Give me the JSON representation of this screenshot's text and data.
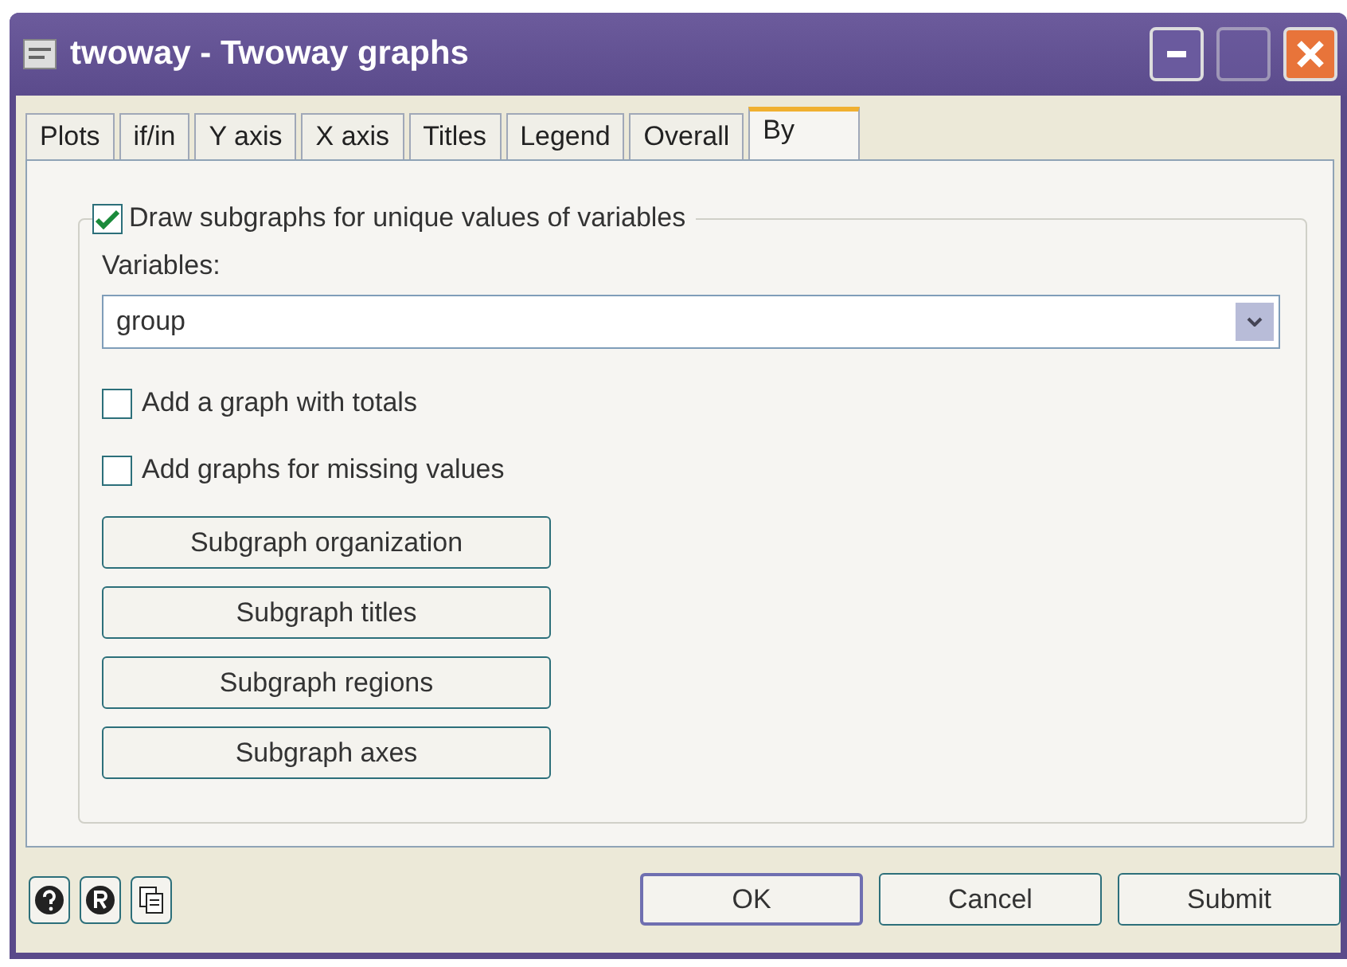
{
  "window": {
    "title": "twoway - Twoway graphs"
  },
  "tabs": [
    {
      "label": "Plots",
      "selected": false
    },
    {
      "label": "if/in",
      "selected": false
    },
    {
      "label": "Y axis",
      "selected": false
    },
    {
      "label": "X axis",
      "selected": false
    },
    {
      "label": "Titles",
      "selected": false
    },
    {
      "label": "Legend",
      "selected": false
    },
    {
      "label": "Overall",
      "selected": false
    },
    {
      "label": "By",
      "selected": true
    }
  ],
  "by_group": {
    "label": "Draw subgraphs for unique values of variables",
    "checked": true
  },
  "variables": {
    "label": "Variables:",
    "value": "group"
  },
  "options": [
    {
      "label": "Add a graph with totals",
      "checked": false
    },
    {
      "label": "Add graphs for missing values",
      "checked": false
    }
  ],
  "subgraph_buttons": [
    "Subgraph organization",
    "Subgraph titles",
    "Subgraph regions",
    "Subgraph axes"
  ],
  "footer_buttons": [
    {
      "label": "OK",
      "selected": true
    },
    {
      "label": "Cancel",
      "selected": false
    },
    {
      "label": "Submit",
      "selected": false
    }
  ]
}
